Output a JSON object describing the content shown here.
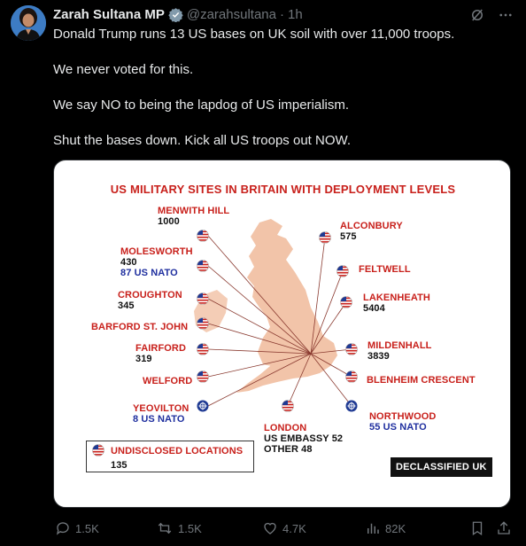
{
  "author": {
    "name": "Zarah Sultana MP",
    "handle": "@zarahsultana",
    "separator": "·",
    "time": "1h"
  },
  "tweet": {
    "paragraphs": [
      "Donald Trump runs 13 US bases on UK soil with over 11,000 troops.",
      "We never voted for this.",
      "We say NO to being the lapdog of US imperialism.",
      "Shut the bases down. Kick all US troops out NOW."
    ]
  },
  "map": {
    "title": "US MILITARY SITES IN BRITAIN WITH DEPLOYMENT LEVELS",
    "sites": {
      "menwith_hill": {
        "name": "MENWITH HILL",
        "count": "1000"
      },
      "molesworth": {
        "name": "MOLESWORTH",
        "count": "430",
        "nato": "87 US NATO"
      },
      "croughton": {
        "name": "CROUGHTON",
        "count": "345"
      },
      "barford": {
        "name": "BARFORD ST. JOHN"
      },
      "fairford": {
        "name": "FAIRFORD",
        "count": "319"
      },
      "welford": {
        "name": "WELFORD"
      },
      "yeovilton": {
        "name": "YEOVILTON",
        "nato": "8 US NATO"
      },
      "alconbury": {
        "name": "ALCONBURY",
        "count": "575"
      },
      "feltwell": {
        "name": "FELTWELL"
      },
      "lakenheath": {
        "name": "LAKENHEATH",
        "count": "5404"
      },
      "mildenhall": {
        "name": "MILDENHALL",
        "count": "3839"
      },
      "blenheim": {
        "name": "BLENHEIM CRESCENT"
      },
      "northwood": {
        "name": "NORTHWOOD",
        "nato": "55 US NATO"
      },
      "london": {
        "name": "LONDON",
        "embassy": "US EMBASSY 52",
        "other": "OTHER 48"
      }
    },
    "legend": {
      "label": "UNDISCLOSED LOCATIONS",
      "count": "135"
    },
    "brand": "DECLASSIFIED UK",
    "colors": {
      "red": "#c8201b",
      "blue": "#1f2f9f",
      "land": "#f2c4a9"
    }
  },
  "actions": {
    "replies": "1.5K",
    "reposts": "1.5K",
    "likes": "4.7K",
    "views": "82K"
  }
}
